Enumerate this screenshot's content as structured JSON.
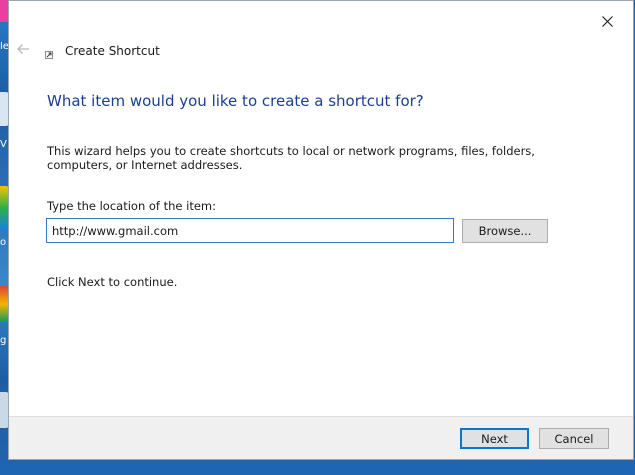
{
  "wizard": {
    "title": "Create Shortcut",
    "question": "What item would you like to create a shortcut for?",
    "description": "This wizard helps you to create shortcuts to local or network programs, files, folders, computers, or Internet addresses.",
    "location_label": "Type the location of the item:",
    "location_value": "http://www.gmail.com",
    "browse_label": "Browse...",
    "continue_text": "Click Next to continue.",
    "next_label": "Next",
    "cancel_label": "Cancel"
  },
  "icons": {
    "close": "close-icon",
    "back": "back-arrow-icon",
    "shortcut": "shortcut-icon"
  },
  "colors": {
    "accent": "#0078d7",
    "heading": "#1a3f8f",
    "desktop": "#1d63a8"
  }
}
